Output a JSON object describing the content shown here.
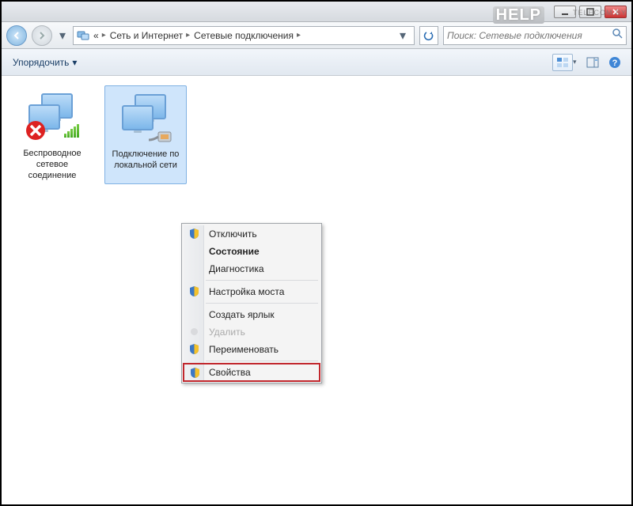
{
  "window_buttons": {
    "min": "minimize",
    "max": "maximize",
    "close": "close"
  },
  "breadcrumbs": {
    "root_hint": "«",
    "seg1": "Сеть и Интернет",
    "seg2": "Сетевые подключения"
  },
  "search": {
    "placeholder": "Поиск: Сетевые подключения"
  },
  "toolbar": {
    "organize": "Упорядочить"
  },
  "items": [
    {
      "label": "Беспроводное сетевое соединение"
    },
    {
      "label": "Подключение по локальной сети"
    }
  ],
  "context_menu": {
    "disable": "Отключить",
    "status": "Состояние",
    "diagnose": "Диагностика",
    "bridge": "Настройка моста",
    "shortcut": "Создать ярлык",
    "delete": "Удалить",
    "rename": "Переименовать",
    "properties": "Свойства"
  },
  "watermark": {
    "main": "HELP",
    "sub": "TELECOM.BY"
  }
}
